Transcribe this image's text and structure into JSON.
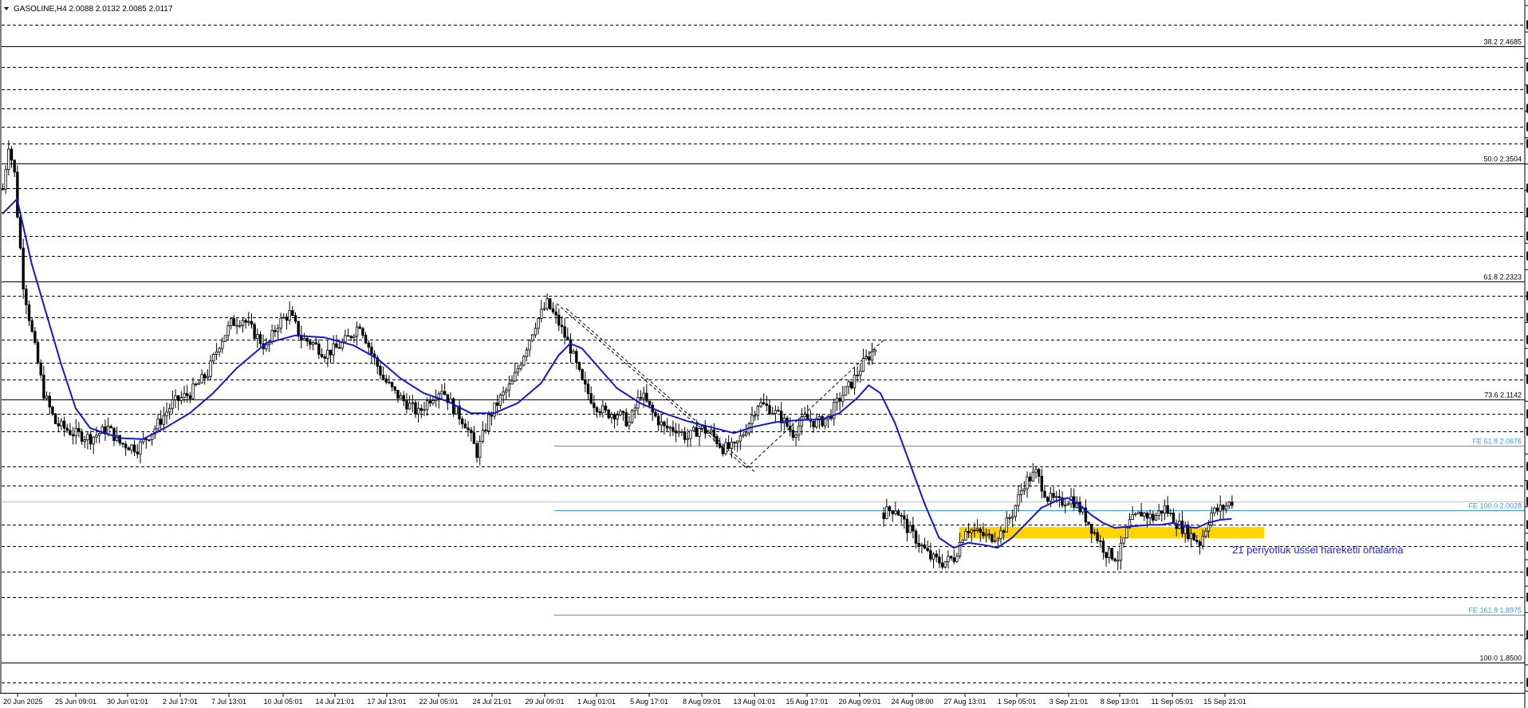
{
  "header": {
    "symbol": "GASOLINE,H4",
    "ohlc": "2.0088 2.0132 2.0085 2.0117"
  },
  "colors": {
    "background": "#ffffff",
    "candle": "#000000",
    "ema": "#1515d8",
    "fib_line": "#000000",
    "fe_line": "#3b9bd6",
    "zone": "#ffd400",
    "note_text": "#1f1fff"
  },
  "chart_data": {
    "type": "candlestick",
    "ylim": [
      1.821,
      2.509
    ],
    "y_ticks": [
      "2.5090",
      "2.4825",
      "2.4560",
      "2.4295",
      "2.4030",
      "2.3765",
      "2.3500",
      "2.3235",
      "2.2970",
      "2.2705",
      "2.2440",
      "2.2175",
      "2.1910",
      "2.1650",
      "2.1385",
      "2.1120",
      "2.0855",
      "2.0590",
      "2.0325",
      "2.0060",
      "1.9795",
      "1.9530",
      "1.9265",
      "1.9000",
      "1.8735",
      "1.8475",
      "1.8210"
    ],
    "dashed_levels": [
      {
        "price": 2.49,
        "label": "2.4900"
      },
      {
        "price": 2.4475,
        "label": "2.4475"
      },
      {
        "price": 2.425,
        "label": "2.4250"
      },
      {
        "price": 2.406,
        "label": "2.4060"
      },
      {
        "price": 2.3875,
        "label": "2.3875"
      },
      {
        "price": 2.3705,
        "label": "2.3705"
      },
      {
        "price": 2.3255,
        "label": "2.3255"
      },
      {
        "price": 2.302,
        "label": "2.3020"
      },
      {
        "price": 2.278,
        "label": "2.2780"
      },
      {
        "price": 2.258,
        "label": "2.2580"
      },
      {
        "price": 2.218,
        "label": "2.2180"
      },
      {
        "price": 2.1965,
        "label": "2.1965"
      },
      {
        "price": 2.1735,
        "label": "2.1735"
      },
      {
        "price": 2.151,
        "label": "2.1510"
      },
      {
        "price": 2.1335,
        "label": "2.1335"
      },
      {
        "price": 2.099,
        "label": "2.0990"
      },
      {
        "price": 2.0815,
        "label": "2.0815"
      },
      {
        "price": 2.0465,
        "label": "2.0465"
      },
      {
        "price": 2.027,
        "label": "2.0270"
      },
      {
        "price": 1.988,
        "label": "1.9880"
      },
      {
        "price": 1.9665,
        "label": "1.9665"
      },
      {
        "price": 1.941,
        "label": "1.9410"
      },
      {
        "price": 1.9155,
        "label": "1.9155"
      },
      {
        "price": 1.8775,
        "label": "1.8775"
      },
      {
        "price": 1.83,
        "label": "1.8300"
      }
    ],
    "current_price": {
      "price": 2.0117,
      "label": "2.0117"
    },
    "fib_levels": [
      {
        "price": 2.4685,
        "label": "38.2 2.4685"
      },
      {
        "price": 2.3504,
        "label": "50.0 2.3504"
      },
      {
        "price": 2.2323,
        "label": "61.8 2.2323"
      },
      {
        "price": 2.1142,
        "label": "73.6 2.1142"
      },
      {
        "price": 1.85,
        "label": "100.0 1.8500"
      }
    ],
    "fe_levels": [
      {
        "price": 2.0676,
        "label": "FE 61.8 2.0676"
      },
      {
        "price": 2.0028,
        "label": "FE 100.0 2.0028"
      },
      {
        "price": 1.8975,
        "label": "FE 161.8 1.8975"
      }
    ],
    "x_labels": [
      "20 Jun 2025",
      "25 Jun 09:01",
      "30 Jun 01:01",
      "2 Jul 17:01",
      "7 Jul 13:01",
      "10 Jul 05:01",
      "14 Jul 21:01",
      "17 Jul 13:01",
      "22 Jul 05:01",
      "24 Jul 21:01",
      "29 Jul 09:01",
      "1 Aug 01:01",
      "5 Aug 17:01",
      "8 Aug 09:01",
      "13 Aug 01:01",
      "15 Aug 17:01",
      "20 Aug 09:01",
      "24 Aug 08:00",
      "27 Aug 13:01",
      "1 Sep 05:01",
      "3 Sep 21:01",
      "8 Sep 13:01",
      "11 Sep 05:01",
      "15 Sep 21:01"
    ],
    "anchors": [
      [
        0,
        2.325
      ],
      [
        2,
        2.37
      ],
      [
        4,
        2.34
      ],
      [
        5,
        2.3
      ],
      [
        7,
        2.23
      ],
      [
        10,
        2.18
      ],
      [
        14,
        2.12
      ],
      [
        18,
        2.09
      ],
      [
        24,
        2.08
      ],
      [
        30,
        2.075
      ],
      [
        36,
        2.085
      ],
      [
        40,
        2.07
      ],
      [
        46,
        2.065
      ],
      [
        52,
        2.085
      ],
      [
        58,
        2.11
      ],
      [
        64,
        2.12
      ],
      [
        70,
        2.14
      ],
      [
        74,
        2.17
      ],
      [
        78,
        2.19
      ],
      [
        82,
        2.195
      ],
      [
        86,
        2.18
      ],
      [
        90,
        2.165
      ],
      [
        94,
        2.19
      ],
      [
        98,
        2.2
      ],
      [
        102,
        2.175
      ],
      [
        106,
        2.17
      ],
      [
        110,
        2.16
      ],
      [
        114,
        2.165
      ],
      [
        118,
        2.175
      ],
      [
        122,
        2.19
      ],
      [
        126,
        2.16
      ],
      [
        130,
        2.135
      ],
      [
        134,
        2.12
      ],
      [
        138,
        2.11
      ],
      [
        142,
        2.1
      ],
      [
        146,
        2.115
      ],
      [
        150,
        2.125
      ],
      [
        154,
        2.105
      ],
      [
        158,
        2.09
      ],
      [
        162,
        2.06
      ],
      [
        166,
        2.095
      ],
      [
        170,
        2.115
      ],
      [
        174,
        2.13
      ],
      [
        178,
        2.16
      ],
      [
        182,
        2.19
      ],
      [
        186,
        2.21
      ],
      [
        190,
        2.19
      ],
      [
        194,
        2.165
      ],
      [
        198,
        2.13
      ],
      [
        202,
        2.11
      ],
      [
        206,
        2.1
      ],
      [
        210,
        2.1
      ],
      [
        214,
        2.09
      ],
      [
        218,
        2.12
      ],
      [
        222,
        2.1
      ],
      [
        226,
        2.085
      ],
      [
        230,
        2.085
      ],
      [
        234,
        2.075
      ],
      [
        238,
        2.085
      ],
      [
        242,
        2.08
      ],
      [
        246,
        2.065
      ],
      [
        250,
        2.065
      ],
      [
        254,
        2.085
      ],
      [
        258,
        2.11
      ],
      [
        262,
        2.105
      ],
      [
        266,
        2.095
      ],
      [
        270,
        2.08
      ],
      [
        274,
        2.095
      ],
      [
        278,
        2.09
      ],
      [
        282,
        2.095
      ],
      [
        286,
        2.115
      ],
      [
        290,
        2.13
      ],
      [
        294,
        2.15
      ],
      [
        298,
        2.165
      ],
      [
        301,
        2.0
      ],
      [
        305,
        2.005
      ],
      [
        309,
        1.985
      ],
      [
        313,
        1.97
      ],
      [
        317,
        1.955
      ],
      [
        321,
        1.95
      ],
      [
        325,
        1.955
      ],
      [
        329,
        1.985
      ],
      [
        333,
        1.98
      ],
      [
        337,
        1.975
      ],
      [
        341,
        1.98
      ],
      [
        345,
        2.0
      ],
      [
        349,
        2.03
      ],
      [
        353,
        2.04
      ],
      [
        357,
        2.015
      ],
      [
        361,
        2.01
      ],
      [
        365,
        2.015
      ],
      [
        369,
        2.0
      ],
      [
        373,
        1.98
      ],
      [
        377,
        1.96
      ],
      [
        381,
        1.955
      ],
      [
        385,
        1.99
      ],
      [
        389,
        2.0
      ],
      [
        393,
        1.995
      ],
      [
        397,
        2.005
      ],
      [
        401,
        1.99
      ],
      [
        405,
        1.98
      ],
      [
        409,
        1.97
      ],
      [
        413,
        2.0
      ],
      [
        417,
        2.005
      ],
      [
        420,
        2.0117
      ]
    ],
    "ema": [
      [
        0,
        2.3
      ],
      [
        5,
        2.315
      ],
      [
        10,
        2.25
      ],
      [
        20,
        2.15
      ],
      [
        25,
        2.105
      ],
      [
        30,
        2.085
      ],
      [
        40,
        2.075
      ],
      [
        48,
        2.074
      ],
      [
        56,
        2.086
      ],
      [
        64,
        2.1
      ],
      [
        72,
        2.12
      ],
      [
        80,
        2.145
      ],
      [
        90,
        2.17
      ],
      [
        100,
        2.178
      ],
      [
        110,
        2.176
      ],
      [
        120,
        2.168
      ],
      [
        128,
        2.155
      ],
      [
        136,
        2.135
      ],
      [
        144,
        2.12
      ],
      [
        152,
        2.112
      ],
      [
        160,
        2.1
      ],
      [
        168,
        2.1
      ],
      [
        176,
        2.11
      ],
      [
        184,
        2.13
      ],
      [
        190,
        2.158
      ],
      [
        194,
        2.17
      ],
      [
        198,
        2.165
      ],
      [
        204,
        2.145
      ],
      [
        210,
        2.125
      ],
      [
        218,
        2.11
      ],
      [
        226,
        2.1
      ],
      [
        234,
        2.092
      ],
      [
        242,
        2.086
      ],
      [
        250,
        2.08
      ],
      [
        256,
        2.086
      ],
      [
        264,
        2.091
      ],
      [
        272,
        2.093
      ],
      [
        280,
        2.094
      ],
      [
        286,
        2.1
      ],
      [
        292,
        2.115
      ],
      [
        296,
        2.128
      ],
      [
        300,
        2.12
      ],
      [
        305,
        2.09
      ],
      [
        310,
        2.05
      ],
      [
        315,
        2.01
      ],
      [
        320,
        1.975
      ],
      [
        325,
        1.965
      ],
      [
        330,
        1.97
      ],
      [
        335,
        1.968
      ],
      [
        340,
        1.965
      ],
      [
        345,
        1.975
      ],
      [
        350,
        1.99
      ],
      [
        355,
        2.005
      ],
      [
        360,
        2.012
      ],
      [
        364,
        2.015
      ],
      [
        368,
        2.008
      ],
      [
        372,
        1.998
      ],
      [
        376,
        1.99
      ],
      [
        380,
        1.985
      ],
      [
        384,
        1.986
      ],
      [
        388,
        1.987
      ],
      [
        392,
        1.988
      ],
      [
        396,
        1.988
      ],
      [
        400,
        1.99
      ],
      [
        404,
        1.986
      ],
      [
        408,
        1.985
      ],
      [
        412,
        1.99
      ],
      [
        416,
        1.993
      ],
      [
        420,
        1.994
      ]
    ],
    "annotation": "21 periyotluk üssel hareketli ortalama"
  }
}
